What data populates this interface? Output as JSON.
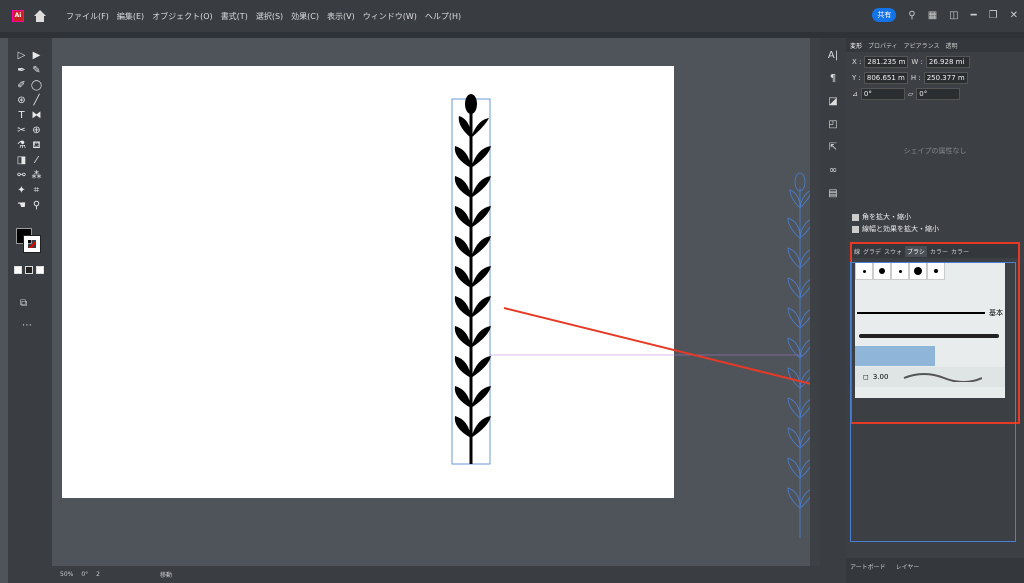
{
  "menubar": {
    "app_logo": "Ai",
    "items": [
      "ファイル(F)",
      "編集(E)",
      "オブジェクト(O)",
      "書式(T)",
      "選択(S)",
      "効果(C)",
      "表示(V)",
      "ウィンドウ(W)",
      "ヘルプ(H)"
    ],
    "share": "共有"
  },
  "zoom": "50%",
  "rotation": "0°",
  "page": "2",
  "status": "移動",
  "transform": {
    "tabs": [
      "変形",
      "プロパティ",
      "アピアランス",
      "透明"
    ],
    "x_label": "X :",
    "x_value": "281.235 m",
    "w_label": "W :",
    "w_value": "26.928 mi",
    "y_label": "Y :",
    "y_value": "806.651 m",
    "h_label": "H :",
    "h_value": "250.377 m",
    "angle": "0°",
    "shear": "0°",
    "no_shape": "シェイプの属性なし"
  },
  "checks": [
    "角を拡大・縮小",
    "線幅と効果を拡大・縮小"
  ],
  "brush_panel": {
    "tabs": [
      "線",
      "グラデ",
      "スウォ",
      "ブラシ",
      "カラー",
      "カラー"
    ],
    "basic_label": "基本",
    "size_value": "3.00"
  },
  "bottom_tabs": [
    "アートボード",
    "レイヤー"
  ]
}
